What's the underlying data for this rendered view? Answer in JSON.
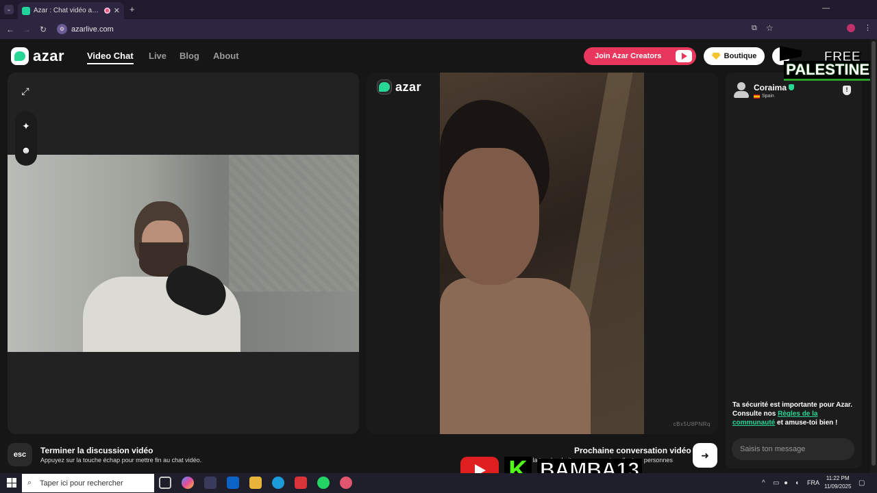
{
  "browser": {
    "tab_title": "Azar : Chat vidéo avec de n",
    "url": "azarlive.com"
  },
  "header": {
    "logo": "azar",
    "nav": [
      "Video Chat",
      "Live",
      "Blog",
      "About"
    ],
    "creators_button": "Join Azar Creators",
    "boutique_button": "Boutique"
  },
  "overlay_badge": {
    "line1": "FREE",
    "line2": "PALESTINE"
  },
  "video": {
    "logo": "azar",
    "peer_id": "cBx5U8PNRq"
  },
  "chat": {
    "peer_name": "Coraima",
    "peer_country": "Spain",
    "safety_text_1": "Ta sécurité est importante pour Azar. Consulte nos ",
    "safety_link": "Règles de la communauté",
    "safety_text_2": " et amuse-toi bien !",
    "input_placeholder": "Saisis ton message"
  },
  "controls": {
    "esc_label": "esc",
    "end_title": "Terminer la discussion vidéo",
    "end_hint": "Appuyez sur la touche échap pour mettre fin au chat vidéo.",
    "next_title": "Prochaine conversation vidéo",
    "next_hint": "r la touche droite pour rencontrer d'autres personnes"
  },
  "stream_overlay": {
    "kick_letter": "K",
    "handle": "BAMBA13"
  },
  "taskbar": {
    "search_placeholder": "Taper ici pour rechercher",
    "language": "FRA",
    "time": "11:22 PM",
    "date": "11/09/2025"
  },
  "colors": {
    "brand_green": "#27d795",
    "creators_red": "#e8365c",
    "background": "#161616"
  }
}
